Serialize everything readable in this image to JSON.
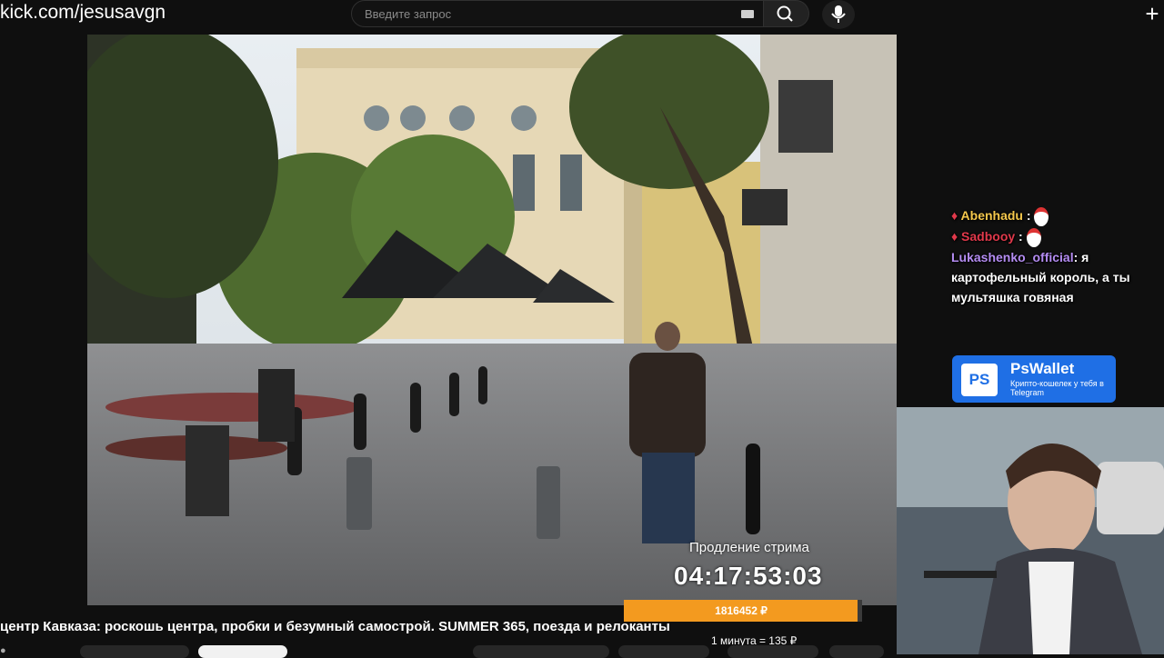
{
  "browser": {
    "url": "kick.com/jesusavgn",
    "search_placeholder": "Введите запрос"
  },
  "chat": [
    {
      "user": "Abenhadu",
      "message": "",
      "color": "#f5c84c",
      "emote": "santa-emote"
    },
    {
      "user": "Sadbooy",
      "message": "",
      "color": "#e0394b",
      "emote": "santa-emote"
    },
    {
      "user": "Lukashenko_official",
      "message": ": я картофельный король, а ты мультяшка говяная",
      "color": "#b48cf2"
    }
  ],
  "ad": {
    "brand": "PsWallet",
    "logo": "PS",
    "tagline": "Крипто-кошелек у тебя в Telegram"
  },
  "stream_extension": {
    "label": "Продление стрима",
    "timer": "04:17:53:03",
    "amount": "1816452 ₽",
    "progress": 0.98,
    "rate": "1 минута = 135 ₽"
  },
  "video": {
    "title": "центр Кавказа: роскошь центра, пробки и безумный самострой. SUMMER 365, поезда и релоканты"
  },
  "colors": {
    "accent_orange": "#f39a1f",
    "ad_blue": "#1f6fe5"
  }
}
